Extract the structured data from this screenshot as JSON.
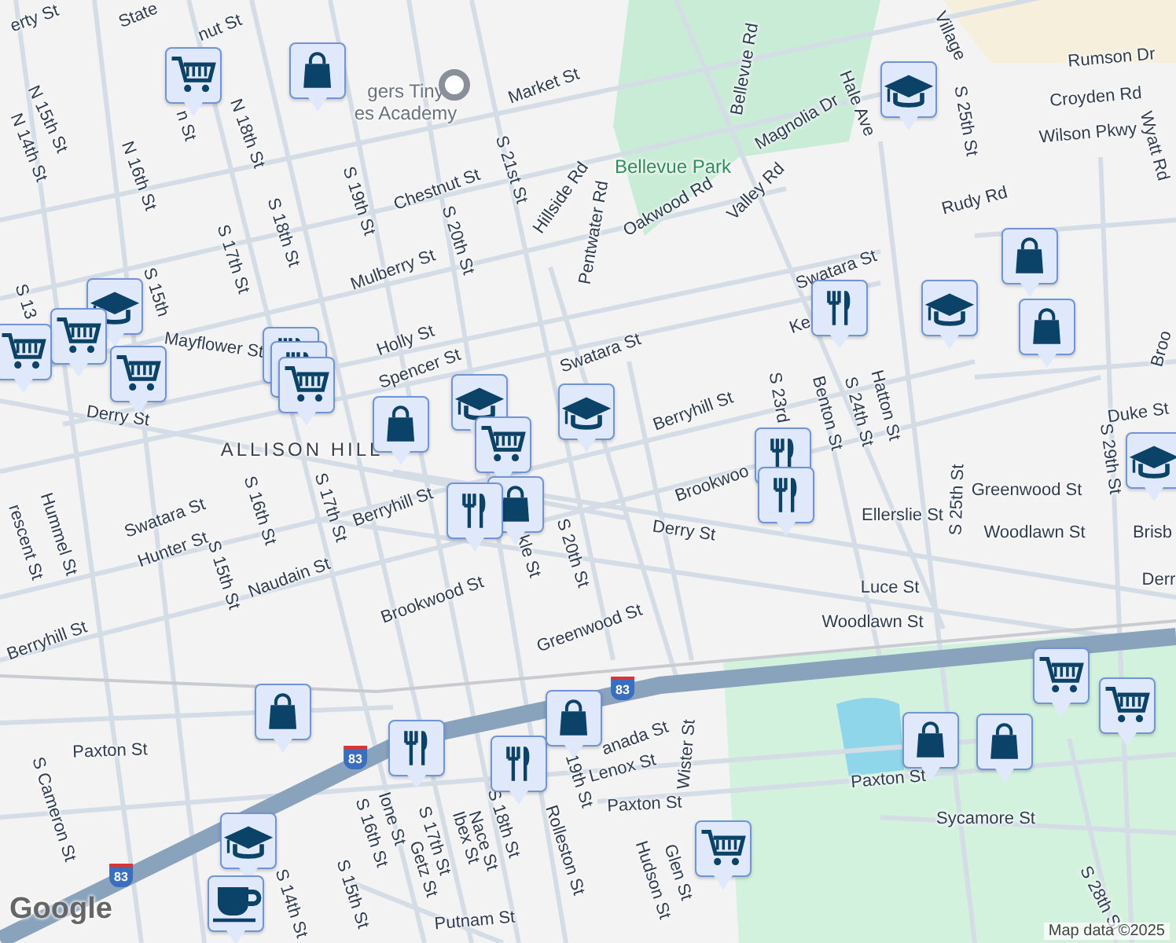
{
  "map": {
    "labels": [
      {
        "text": "erty St",
        "kind": "street"
      },
      {
        "text": "State",
        "kind": "street"
      },
      {
        "text": "nut St",
        "kind": "street"
      },
      {
        "text": "N 15th St",
        "kind": "street"
      },
      {
        "text": "N 14th St",
        "kind": "street"
      },
      {
        "text": "N 16th St",
        "kind": "street"
      },
      {
        "text": "n St",
        "kind": "street"
      },
      {
        "text": "N 18th St",
        "kind": "street"
      },
      {
        "text": "gers Tiny",
        "kind": "place"
      },
      {
        "text": "es Academy",
        "kind": "place"
      },
      {
        "text": "Market St",
        "kind": "street"
      },
      {
        "text": "S 21st St",
        "kind": "street"
      },
      {
        "text": "Chestnut St",
        "kind": "street"
      },
      {
        "text": "S 19th St",
        "kind": "street"
      },
      {
        "text": "S 20th St",
        "kind": "street"
      },
      {
        "text": "S 18th St",
        "kind": "street"
      },
      {
        "text": "S 17th St",
        "kind": "street"
      },
      {
        "text": "S 15th",
        "kind": "street"
      },
      {
        "text": "S 13",
        "kind": "street"
      },
      {
        "text": "Mulberry St",
        "kind": "street"
      },
      {
        "text": "Holly St",
        "kind": "street"
      },
      {
        "text": "Spencer St",
        "kind": "street"
      },
      {
        "text": "Mayflower St",
        "kind": "street"
      },
      {
        "text": "Derry St",
        "kind": "street"
      },
      {
        "text": "ALLISON HILL",
        "kind": "area"
      },
      {
        "text": "Bellevue Park",
        "kind": "park"
      },
      {
        "text": "Hillside Rd",
        "kind": "street"
      },
      {
        "text": "Pentwater Rd",
        "kind": "street"
      },
      {
        "text": "Bellevue Rd",
        "kind": "street"
      },
      {
        "text": "Magnolia Dr",
        "kind": "street"
      },
      {
        "text": "Oakwood Rd",
        "kind": "street"
      },
      {
        "text": "Valley Rd",
        "kind": "street"
      },
      {
        "text": "Hale Ave",
        "kind": "street"
      },
      {
        "text": "Rudy Rd",
        "kind": "street"
      },
      {
        "text": "Village",
        "kind": "street"
      },
      {
        "text": "S 25th St",
        "kind": "street"
      },
      {
        "text": "Rumson Dr",
        "kind": "street"
      },
      {
        "text": "Croyden Rd",
        "kind": "street"
      },
      {
        "text": "Wilson Pkwy",
        "kind": "street"
      },
      {
        "text": "Wyatt Rd",
        "kind": "street"
      },
      {
        "text": "Swatara St",
        "kind": "street"
      },
      {
        "text": "Ke",
        "kind": "street"
      },
      {
        "text": "Swatara St",
        "kind": "street"
      },
      {
        "text": "Berryhill St",
        "kind": "street"
      },
      {
        "text": "S 23rd",
        "kind": "street"
      },
      {
        "text": "Benton St",
        "kind": "street"
      },
      {
        "text": "S 24th St",
        "kind": "street"
      },
      {
        "text": "Hatton St",
        "kind": "street"
      },
      {
        "text": "Duke St",
        "kind": "street"
      },
      {
        "text": "S 29th St",
        "kind": "street"
      },
      {
        "text": "Broo",
        "kind": "street"
      },
      {
        "text": "Brookwoo",
        "kind": "street"
      },
      {
        "text": "Derry St",
        "kind": "street"
      },
      {
        "text": "S 25th St",
        "kind": "street"
      },
      {
        "text": "Greenwood St",
        "kind": "street"
      },
      {
        "text": "Ellerslie St",
        "kind": "street"
      },
      {
        "text": "Woodlawn St",
        "kind": "street"
      },
      {
        "text": "Brisb",
        "kind": "street"
      },
      {
        "text": "Derr",
        "kind": "street"
      },
      {
        "text": "Luce St",
        "kind": "street"
      },
      {
        "text": "Woodlawn St",
        "kind": "street"
      },
      {
        "text": "Greenwood St",
        "kind": "street"
      },
      {
        "text": "Swatara St",
        "kind": "street"
      },
      {
        "text": "Hummel St",
        "kind": "street"
      },
      {
        "text": "rescent St",
        "kind": "street"
      },
      {
        "text": "Hunter St",
        "kind": "street"
      },
      {
        "text": "S 15th St",
        "kind": "street"
      },
      {
        "text": "S 16th St",
        "kind": "street"
      },
      {
        "text": "S 17th St",
        "kind": "street"
      },
      {
        "text": "Berryhill St",
        "kind": "street"
      },
      {
        "text": "Naudain St",
        "kind": "street"
      },
      {
        "text": "Brookwood St",
        "kind": "street"
      },
      {
        "text": "Berryhill St",
        "kind": "street"
      },
      {
        "text": "S 20th St",
        "kind": "street"
      },
      {
        "text": "kle St",
        "kind": "street"
      },
      {
        "text": "Paxton St",
        "kind": "street"
      },
      {
        "text": "S Cameron St",
        "kind": "street"
      },
      {
        "text": "Ione St",
        "kind": "street"
      },
      {
        "text": "S 16th St",
        "kind": "street"
      },
      {
        "text": "S 17th St",
        "kind": "street"
      },
      {
        "text": "Getz St",
        "kind": "street"
      },
      {
        "text": "Ibex St",
        "kind": "street"
      },
      {
        "text": "Nace St",
        "kind": "street"
      },
      {
        "text": "S 18th St",
        "kind": "street"
      },
      {
        "text": "Rolleston St",
        "kind": "street"
      },
      {
        "text": "19th St",
        "kind": "street"
      },
      {
        "text": "anada St",
        "kind": "street"
      },
      {
        "text": "Lenox St",
        "kind": "street"
      },
      {
        "text": "Wister St",
        "kind": "street"
      },
      {
        "text": "Paxton St",
        "kind": "street"
      },
      {
        "text": "Glen St",
        "kind": "street"
      },
      {
        "text": "Hudson St",
        "kind": "street"
      },
      {
        "text": "Paxton St",
        "kind": "street"
      },
      {
        "text": "Sycamore St",
        "kind": "street"
      },
      {
        "text": "S 28th St",
        "kind": "street"
      },
      {
        "text": "S 14th St",
        "kind": "street"
      },
      {
        "text": "S 15th St",
        "kind": "street"
      },
      {
        "text": "Putnam St",
        "kind": "street"
      }
    ],
    "highway_shields": [
      "83",
      "83",
      "83"
    ],
    "markers": [
      {
        "kind": "cart"
      },
      {
        "kind": "bag"
      },
      {
        "kind": "school"
      },
      {
        "kind": "cart"
      },
      {
        "kind": "cart"
      },
      {
        "kind": "cart"
      },
      {
        "kind": "food"
      },
      {
        "kind": "food"
      },
      {
        "kind": "cart"
      },
      {
        "kind": "school"
      },
      {
        "kind": "bag"
      },
      {
        "kind": "cart"
      },
      {
        "kind": "school"
      },
      {
        "kind": "school"
      },
      {
        "kind": "food"
      },
      {
        "kind": "school"
      },
      {
        "kind": "bag"
      },
      {
        "kind": "bag"
      },
      {
        "kind": "school"
      },
      {
        "kind": "food"
      },
      {
        "kind": "food"
      },
      {
        "kind": "bag"
      },
      {
        "kind": "food"
      },
      {
        "kind": "bag"
      },
      {
        "kind": "food"
      },
      {
        "kind": "food"
      },
      {
        "kind": "bag"
      },
      {
        "kind": "cart"
      },
      {
        "kind": "cart"
      },
      {
        "kind": "bag"
      },
      {
        "kind": "bag"
      },
      {
        "kind": "cart"
      },
      {
        "kind": "school"
      },
      {
        "kind": "coffee"
      }
    ],
    "logo": "Google",
    "attribution": "Map data ©2025"
  }
}
